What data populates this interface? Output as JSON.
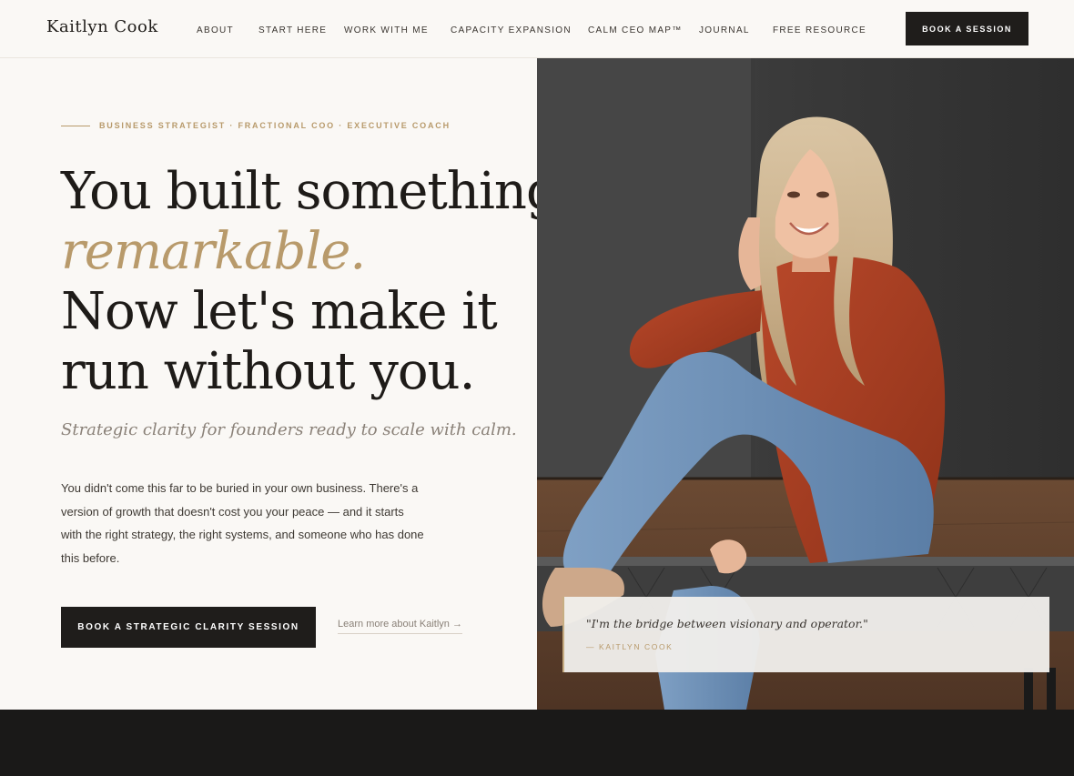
{
  "brand": {
    "name": "Kaitlyn Cook"
  },
  "nav": {
    "links": [
      "About",
      "Start Here",
      "Work With Me",
      "Capacity Expansion",
      "Calm CEO Map™",
      "Journal",
      "Free Resource"
    ],
    "cta": "BOOK A SESSION"
  },
  "hero": {
    "eyebrow": "BUSINESS STRATEGIST · FRACTIONAL COO · EXECUTIVE COACH",
    "headline": {
      "line1": "You built something",
      "accent": "remarkable.",
      "line3": "Now let's make it",
      "line4": "run without you."
    },
    "tagline": "Strategic clarity for founders ready to scale with calm.",
    "body": "You didn't come this far to be buried in your own business. There's a version of growth that doesn't cost you your peace — and it starts with the right strategy, the right systems, and someone who has done this before.",
    "cta_primary": "BOOK A STRATEGIC CLARITY SESSION",
    "cta_secondary": "Learn more about Kaitlyn →"
  },
  "quote": {
    "text": "\"I'm the bridge between visionary and operator.\"",
    "author": "— KAITLYN COOK"
  },
  "icons": {
    "arrow": "arrow-right-icon"
  },
  "colors": {
    "accent": "#b89a6b",
    "dark": "#1f1d1b",
    "background": "#faf8f5"
  }
}
